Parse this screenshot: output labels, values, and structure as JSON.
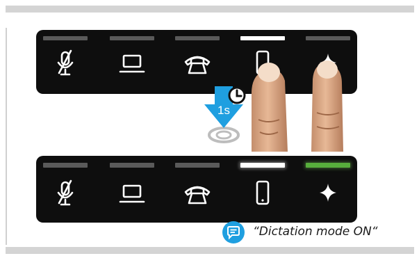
{
  "top_panel": {
    "buttons": [
      {
        "icon": "microphone-muted-icon",
        "led": "off"
      },
      {
        "icon": "laptop-icon",
        "led": "off"
      },
      {
        "icon": "desk-phone-icon",
        "led": "off"
      },
      {
        "icon": "mobile-phone-icon",
        "led": "white"
      },
      {
        "icon": "sparkle-icon",
        "led": "off"
      }
    ]
  },
  "gesture": {
    "hold_duration": "1s",
    "icons": [
      "clock-icon",
      "down-arrow-icon",
      "press-ring-icon",
      "finger-icon"
    ]
  },
  "bottom_panel": {
    "buttons": [
      {
        "icon": "microphone-muted-icon",
        "led": "off"
      },
      {
        "icon": "laptop-icon",
        "led": "off"
      },
      {
        "icon": "desk-phone-icon",
        "led": "off"
      },
      {
        "icon": "mobile-phone-icon",
        "led": "white"
      },
      {
        "icon": "sparkle-icon",
        "led": "green"
      }
    ]
  },
  "voice_prompt": {
    "icon": "speech-bubble-icon",
    "text": "“Dictation mode ON“"
  },
  "colors": {
    "panel": "#0e0e0e",
    "led_off": "#5a5a5a",
    "led_white": "#ffffff",
    "led_green": "#57ae3c",
    "arrow_blue": "#1f9fe0",
    "bubble_blue": "#1f9fe0",
    "rule_gray": "#d4d4d4"
  }
}
